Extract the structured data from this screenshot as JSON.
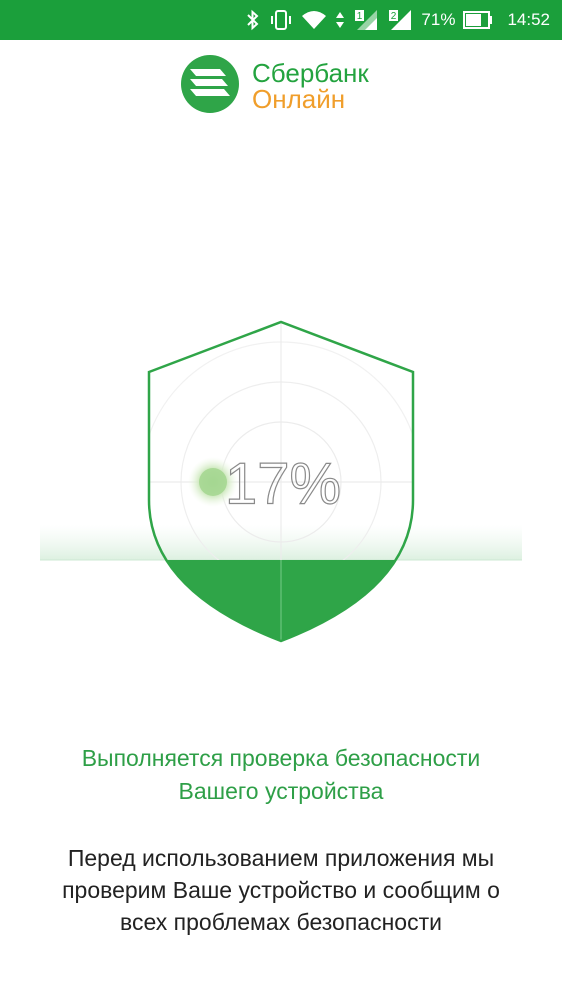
{
  "status_bar": {
    "battery_percent": "71%",
    "time": "14:52",
    "sim1_label": "1",
    "sim2_label": "2",
    "icons": [
      "bluetooth-icon",
      "vibrate-icon",
      "wifi-icon",
      "data-arrows-icon",
      "signal-sim1-icon",
      "signal-sim2-icon",
      "battery-icon"
    ]
  },
  "logo": {
    "line1": "Сбербанк",
    "line2": "Онлайн",
    "colors": {
      "green": "#23a33f",
      "orange": "#f09e2b"
    }
  },
  "scan": {
    "progress_text": "17%",
    "progress_value": 0.17,
    "fill_color": "#2fa548"
  },
  "message": {
    "title_line1": "Выполняется проверка безопасности",
    "title_line2": "Вашего устройства",
    "desc_line1": "Перед использованием приложения мы",
    "desc_line2": "проверим Ваше устройство и сообщим о",
    "desc_line3": "всех проблемах безопасности"
  }
}
